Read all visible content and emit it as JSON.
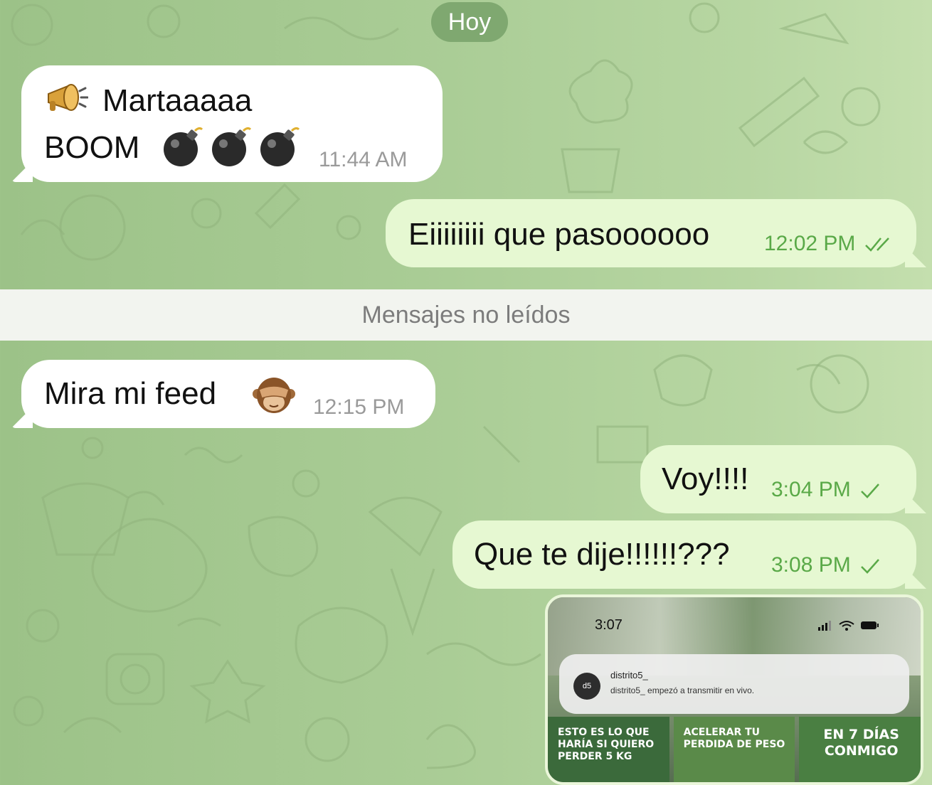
{
  "date_separator": "Hoy",
  "unread_divider": "Mensajes no leídos",
  "messages": [
    {
      "direction": "incoming",
      "line1": "Martaaaaa",
      "line2": "BOOM",
      "emoji": [
        "megaphone-icon",
        "bomb-icon",
        "bomb-icon",
        "bomb-icon"
      ],
      "time": "11:44 AM"
    },
    {
      "direction": "outgoing",
      "text": "Eiiiiiiii que pasoooooo",
      "time": "12:02 PM",
      "status": "read"
    },
    {
      "direction": "incoming",
      "text": "Mira mi feed",
      "emoji": [
        "see-no-evil-monkey-icon"
      ],
      "time": "12:15 PM"
    },
    {
      "direction": "outgoing",
      "text": "Voy!!!!",
      "time": "3:04 PM",
      "status": "sent"
    },
    {
      "direction": "outgoing",
      "text": "Que te dije!!!!!!???",
      "time": "3:08 PM",
      "status": "sent"
    }
  ],
  "attachment": {
    "status_time": "3:07",
    "notification": {
      "logo_text": "d5",
      "title": "distrito5_",
      "body": "distrito5_ empezó a transmitir en vivo."
    },
    "tiles": [
      "ESTO ES LO QUE HARÍA SI QUIERO PERDER 5 KG",
      "ACELERAR TU PERDIDA DE PESO",
      "EN 7 DÍAS CONMIGO"
    ]
  },
  "colors": {
    "incoming_bubble": "#ffffff",
    "outgoing_bubble": "#e6f8d2",
    "check": "#5aa948",
    "date_pill": "#7fa870"
  }
}
